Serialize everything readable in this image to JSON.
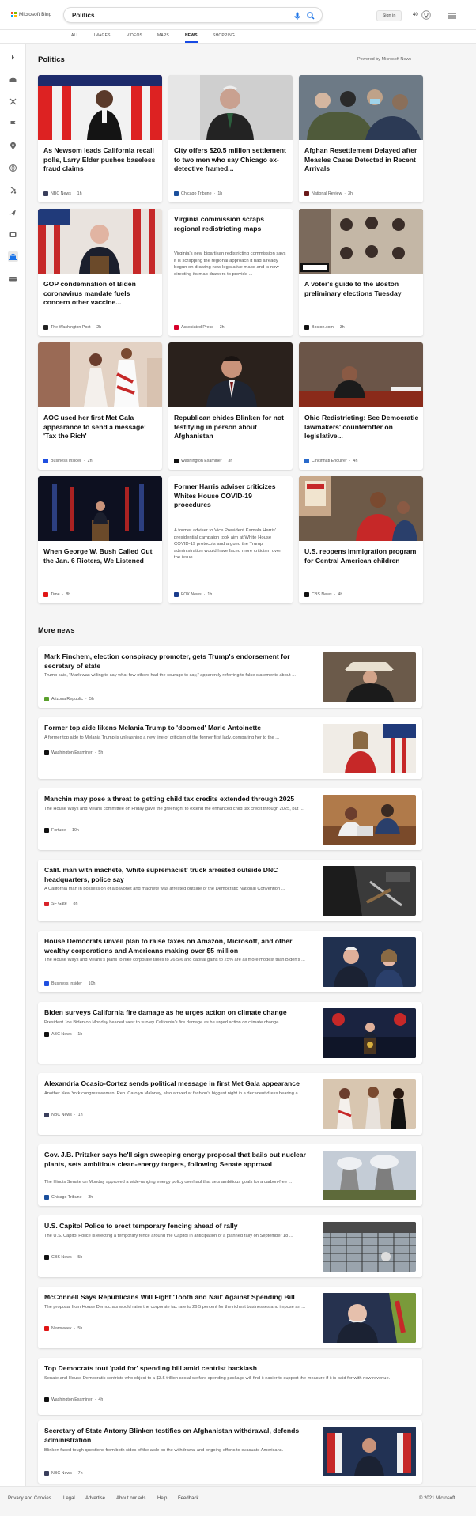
{
  "brand": "Microsoft Bing",
  "search": {
    "query": "Politics"
  },
  "header": {
    "signin": "Sign in",
    "points": "40"
  },
  "tabs": [
    "ALL",
    "IMAGES",
    "VIDEOS",
    "MAPS",
    "NEWS",
    "SHOPPING"
  ],
  "active_tab": "NEWS",
  "sidebar_icons": [
    "collapse-icon",
    "home-icon",
    "sports-icon",
    "flag-icon",
    "location-icon",
    "globe-icon",
    "money-icon",
    "travel-icon",
    "entertainment-icon",
    "politics-icon",
    "video-icon"
  ],
  "section_title": "Politics",
  "powered_by": "Powered by Microsoft News",
  "cards": [
    {
      "title": "As Newsom leads California recall polls, Larry Elder pushes baseless fraud claims",
      "source": "NBC News",
      "time": "1h",
      "icon": "nbc-icon",
      "color": "#3a3f5c"
    },
    {
      "title": "City offers $20.5 million settlement to two men who say Chicago ex-detective framed...",
      "source": "Chicago Tribune",
      "time": "1h",
      "icon": "chicago-tribune-icon",
      "color": "#1b4f9c"
    },
    {
      "title": "Afghan Resettlement Delayed after Measles Cases Detected in Recent Arrivals",
      "source": "National Review",
      "time": "3h",
      "icon": "national-review-icon",
      "color": "#6b1a1a"
    },
    {
      "title": "GOP condemnation of Biden coronavirus mandate fuels concern other vaccine...",
      "source": "The Washington Post",
      "time": "2h",
      "icon": "washington-post-icon",
      "color": "#222"
    },
    {
      "title": "Virginia commission scraps regional redistricting maps",
      "desc": "Virginia's new bipartisan redistricting commission says it is scrapping the regional approach it had already begun on drawing new legislative maps and is now directing its map drawers to provide ...",
      "source": "Associated Press",
      "time": "3h",
      "icon": "ap-icon",
      "color": "#d6002a"
    },
    {
      "title": "A voter's guide to the Boston preliminary elections Tuesday",
      "source": "Boston.com",
      "time": "3h",
      "icon": "boston-icon",
      "color": "#111"
    },
    {
      "title": "AOC used her first Met Gala appearance to send a message: 'Tax the Rich'",
      "source": "Business Insider",
      "time": "2h",
      "icon": "business-insider-icon",
      "color": "#1f4fe0"
    },
    {
      "title": "Republican chides Blinken for not testifying in person about Afghanistan",
      "source": "Washington Examiner",
      "time": "3h",
      "icon": "washington-examiner-icon",
      "color": "#111"
    },
    {
      "title": "Ohio Redistricting: See Democratic lawmakers' counteroffer on legislative...",
      "source": "Cincinnati Enquirer",
      "time": "4h",
      "icon": "cincinnati-enquirer-icon",
      "color": "#2a6acb"
    },
    {
      "title": "When George W. Bush Called Out the Jan. 6 Rioters, We Listened",
      "source": "Time",
      "time": "8h",
      "icon": "time-icon",
      "color": "#e01515"
    },
    {
      "title": "Former Harris adviser criticizes Whites House COVID-19 procedures",
      "desc": "A former adviser to Vice President Kamala Harris' presidential campaign took aim at White House COVID-19 protocols and argued the Trump administration would have faced more criticism over the issue.",
      "source": "FOX News",
      "time": "1h",
      "icon": "fox-news-icon",
      "color": "#1a3c8c"
    },
    {
      "title": "U.S. reopens immigration program for Central American children",
      "source": "CBS News",
      "time": "4h",
      "icon": "cbs-news-icon",
      "color": "#111"
    }
  ],
  "more_title": "More news",
  "more": [
    {
      "title": "Mark Finchem, election conspiracy promoter, gets Trump's endorsement for secretary of state",
      "desc": "Trump said, \"Mark was willing to say what few others had the courage to say,\" apparently referring to false statements about ...",
      "source": "Arizona Republic",
      "time": "5h",
      "icon": "arizona-republic-icon",
      "color": "#5aa02c"
    },
    {
      "title": "Former top aide likens Melania Trump to 'doomed' Marie Antoinette",
      "desc": "A former top aide to Melania Trump is unleashing a new line of criticism of the former first lady, comparing her to the ...",
      "source": "Washington Examiner",
      "time": "5h",
      "icon": "washington-examiner-icon",
      "color": "#111"
    },
    {
      "title": "Manchin may pose a threat to getting child tax credits extended through 2025",
      "desc": "The House Ways and Means committee on Friday gave the greenlight to extend the enhanced child tax credit through 2025, but ...",
      "source": "Fortune",
      "time": "10h",
      "icon": "fortune-icon",
      "color": "#111"
    },
    {
      "title": "Calif. man with machete, 'white supremacist' truck arrested outside DNC headquarters, police say",
      "desc": "A California man in possession of a bayonet and machete was arrested outside of the Democratic National Convention ...",
      "source": "SF Gate",
      "time": "8h",
      "icon": "sf-gate-icon",
      "color": "#d8232a"
    },
    {
      "title": "House Democrats unveil plan to raise taxes on Amazon, Microsoft, and other wealthy corporations and Americans making over $5 million",
      "desc": "The House Ways and Means's plans to hike corporate taxes to 26.5% and capital gains to 25% are all more modest than Biden's ...",
      "source": "Business Insider",
      "time": "10h",
      "icon": "business-insider-icon",
      "color": "#1f4fe0"
    },
    {
      "title": "Biden surveys California fire damage as he urges action on climate change",
      "desc": "President Joe Biden on Monday headed west to survey California's fire damage as he urged action on climate change.",
      "source": "ABC News",
      "time": "1h",
      "icon": "abc-news-icon",
      "color": "#111"
    },
    {
      "title": "Alexandria Ocasio-Cortez sends political message in first Met Gala appearance",
      "desc": "Another New York congresswoman, Rep. Carolyn Maloney, also arrived at fashion's biggest night in a decadent dress bearing a ...",
      "source": "NBC News",
      "time": "1h",
      "icon": "nbc-icon",
      "color": "#3a3f5c"
    },
    {
      "title": "Gov. J.B. Pritzker says he'll sign sweeping energy proposal that bails out nuclear plants, sets ambitious clean-energy targets, following Senate approval",
      "desc": "The Illinois Senate on Monday approved a wide-ranging energy policy overhaul that sets ambitious goals for a carbon-free ...",
      "source": "Chicago Tribune",
      "time": "3h",
      "icon": "chicago-tribune-icon",
      "color": "#1b4f9c"
    },
    {
      "title": "U.S. Capitol Police to erect temporary fencing ahead of rally",
      "desc": "The U.S. Capitol Police is erecting a temporary fence around the Capitol in anticipation of a planned rally on September 18 ...",
      "source": "CBS News",
      "time": "5h",
      "icon": "cbs-news-icon",
      "color": "#111"
    },
    {
      "title": "McConnell Says Republicans Will Fight 'Tooth and Nail' Against Spending Bill",
      "desc": "The proposal from House Democrats would raise the corporate tax rate to 26.5 percent for the richest businesses and impose an ...",
      "source": "Newsweek",
      "time": "5h",
      "icon": "newsweek-icon",
      "color": "#e01515"
    },
    {
      "title": "Top Democrats tout 'paid for' spending bill amid centrist backlash",
      "desc": "Senate and House Democratic centrists who object to a $3.5 trillion social welfare spending package will find it easier to support the measure if it is paid for with new revenue.",
      "source": "Washington Examiner",
      "time": "4h",
      "icon": "washington-examiner-icon",
      "color": "#111"
    },
    {
      "title": "Secretary of State Antony Blinken testifies on Afghanistan withdrawal, defends administration",
      "desc": "Blinken faced tough questions from both sides of the aisle on the withdrawal and ongoing efforts to evacuate Americans.",
      "source": "NBC News",
      "time": "7h",
      "icon": "nbc-icon",
      "color": "#3a3f5c"
    }
  ],
  "footer": {
    "links": [
      "Privacy and Cookies",
      "Legal",
      "Advertise",
      "About our ads",
      "Help",
      "Feedback"
    ],
    "copyright": "© 2021 Microsoft"
  }
}
